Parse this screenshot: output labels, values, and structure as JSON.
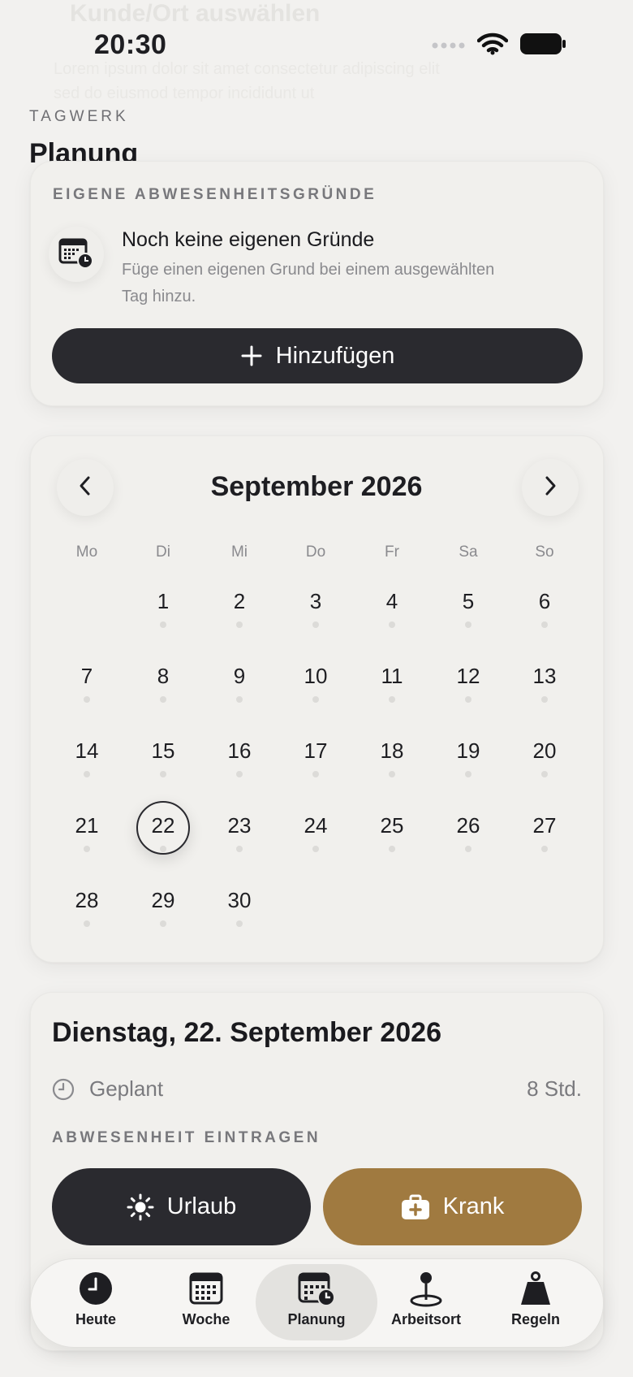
{
  "status_bar": {
    "time": "20:30"
  },
  "header": {
    "app_name": "TAGWERK",
    "title": "Planung"
  },
  "background_ghost": {
    "heading": "Kunde/Ort auswählen",
    "line1": "Lorem ipsum dolor sit amet consectetur adipiscing elit",
    "line2": "sed do eiusmod tempor incididunt ut"
  },
  "custom_reasons": {
    "section_label": "EIGENE ABWESENHEITSGRÜNDE",
    "empty_title": "Noch keine eigenen Gründe",
    "empty_text_1": "Füge einen eigenen Grund bei einem ausgewählten",
    "empty_text_2": "Tag hinzu.",
    "add_icon": "plus-icon",
    "add_label": "Hinzufügen"
  },
  "calendar": {
    "month_label": "September 2026",
    "weekdays": [
      "Mo",
      "Di",
      "Mi",
      "Do",
      "Fr",
      "Sa",
      "So"
    ],
    "first_weekday_index": 1,
    "days_in_month": 30,
    "selected_day": 22,
    "prev_icon": "chevron-left-icon",
    "next_icon": "chevron-right-icon"
  },
  "day_detail": {
    "date_title": "Dienstag, 22. September 2026",
    "planned_label": "Geplant",
    "planned_hours": "8 Std.",
    "absence_label": "ABWESENHEIT EINTRAGEN",
    "vacation_label": "Urlaub",
    "sick_label": "Krank",
    "vacation_icon": "sun-icon",
    "sick_icon": "medical-case-icon"
  },
  "tab_bar": {
    "active": "Planung",
    "items": [
      {
        "label": "Heute",
        "icon": "clock-icon"
      },
      {
        "label": "Woche",
        "icon": "calendar-grid-icon"
      },
      {
        "label": "Planung",
        "icon": "calendar-clock-icon"
      },
      {
        "label": "Arbeitsort",
        "icon": "location-pin-icon"
      },
      {
        "label": "Regeln",
        "icon": "weight-icon"
      }
    ]
  },
  "colors": {
    "background": "#f2f1ef",
    "dark": "#2a2a2f",
    "accent_gold": "#a07a40",
    "muted_text": "#8a8a8e"
  }
}
